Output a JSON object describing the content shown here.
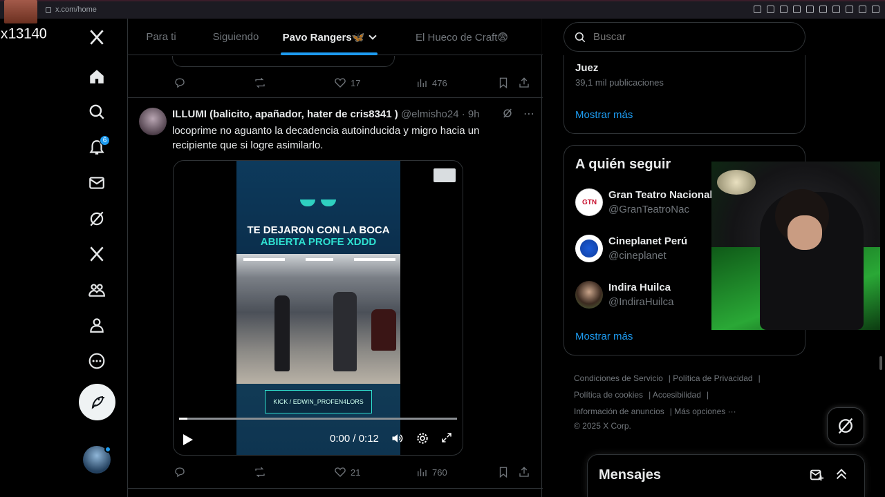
{
  "browser": {
    "url": "x.com/home"
  },
  "overlay": {
    "counter_text": "x13140"
  },
  "nav": {
    "notifications_badge": "6"
  },
  "tabs": [
    {
      "label": "Para ti"
    },
    {
      "label": "Siguiendo"
    },
    {
      "label": "Pavo Rangers🦋"
    },
    {
      "label": "El Hueco de Craft😨"
    }
  ],
  "prev_tweet": {
    "likes": "17",
    "views": "476"
  },
  "tweet": {
    "name": "ILLUMI (balicito, apañador, hater de cris8341 )",
    "handle": "@elmisho24 · 9h",
    "text": "locoprime  no aguanto la decadencia autoinducida  y migro hacia  un recipiente que si logre asimilarlo.",
    "video": {
      "caption_line1": "TE DEJARON CON LA BOCA",
      "caption_line2": "ABIERTA PROFE XDDD",
      "tag": "KICK / EDWIN_PROFEN4LORS",
      "time": "0:00 / 0:12",
      "progress_fraction": 0.03
    },
    "likes": "21",
    "views": "760"
  },
  "search": {
    "placeholder": "Buscar"
  },
  "trend": {
    "name": "Juez",
    "count": "39,1 mil publicaciones",
    "show_more": "Mostrar más"
  },
  "who_to_follow": {
    "title": "A quién seguir",
    "items": [
      {
        "name": "Gran Teatro Nacional",
        "handle": "@GranTeatroNac"
      },
      {
        "name": "Cineplanet Perú",
        "handle": "@cineplanet"
      },
      {
        "name": "Indira Huilca",
        "handle": "@IndiraHuilca"
      }
    ],
    "show_more": "Mostrar más"
  },
  "footer": {
    "links": [
      "Condiciones de Servicio",
      "Política de Privacidad",
      "Política de cookies",
      "Accesibilidad",
      "Información de anuncios",
      "Más opciones ···"
    ],
    "copyright": "© 2025 X Corp."
  },
  "messages": {
    "title": "Mensajes"
  },
  "colors": {
    "accent": "#1d9bf0",
    "background": "#000000",
    "border": "#2f3336",
    "muted": "#71767b"
  }
}
